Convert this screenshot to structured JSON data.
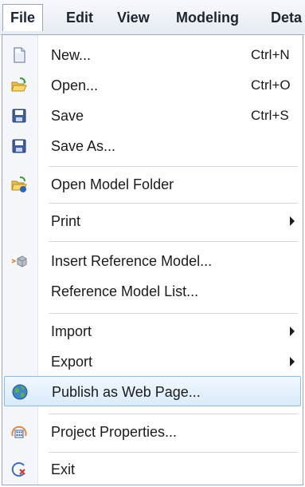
{
  "menubar": {
    "items": [
      {
        "label": "File"
      },
      {
        "label": "Edit"
      },
      {
        "label": "View"
      },
      {
        "label": "Modeling"
      },
      {
        "label": "Deta"
      }
    ]
  },
  "file_menu": {
    "new": {
      "label": "New...",
      "shortcut": "Ctrl+N",
      "icon": "new-document-icon"
    },
    "open": {
      "label": "Open...",
      "shortcut": "Ctrl+O",
      "icon": "open-folder-icon"
    },
    "save": {
      "label": "Save",
      "shortcut": "Ctrl+S",
      "icon": "save-disk-icon"
    },
    "save_as": {
      "label": "Save As...",
      "icon": "save-as-disk-icon"
    },
    "open_model_folder": {
      "label": "Open Model Folder",
      "icon": "model-folder-icon"
    },
    "print": {
      "label": "Print",
      "has_submenu": true
    },
    "insert_reference_model": {
      "label": "Insert Reference Model...",
      "icon": "insert-reference-icon"
    },
    "reference_model_list": {
      "label": "Reference Model List..."
    },
    "import": {
      "label": "Import",
      "has_submenu": true
    },
    "export": {
      "label": "Export",
      "has_submenu": true
    },
    "publish_web_page": {
      "label": "Publish as Web Page...",
      "icon": "globe-icon",
      "highlighted": true
    },
    "project_properties": {
      "label": "Project Properties...",
      "icon": "project-properties-icon"
    },
    "exit": {
      "label": "Exit",
      "icon": "exit-icon"
    }
  },
  "colors": {
    "highlight_border": "#8fb8de",
    "highlight_fill": "#d9ebfa",
    "menubar_bg": "#e7ecf3"
  }
}
